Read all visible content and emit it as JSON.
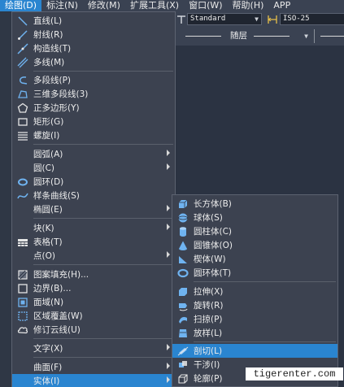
{
  "menubar": [
    {
      "label": "绘图(D)",
      "active": true
    },
    {
      "label": "标注(N)"
    },
    {
      "label": "修改(M)"
    },
    {
      "label": "扩展工具(X)"
    },
    {
      "label": "窗口(W)"
    },
    {
      "label": "帮助(H)"
    },
    {
      "label": "APP"
    }
  ],
  "toolbar": {
    "text_style": "Standard",
    "dim_style": "ISO-25",
    "layer": "随层"
  },
  "draw_menu": {
    "items": [
      {
        "label": "直线(L)",
        "icon": "line-icon"
      },
      {
        "label": "射线(R)",
        "icon": "ray-icon"
      },
      {
        "label": "构造线(T)",
        "icon": "xline-icon"
      },
      {
        "label": "多线(M)",
        "icon": "mline-icon"
      },
      {
        "label": "多段线(P)",
        "icon": "polyline-icon"
      },
      {
        "label": "三维多段线(3)",
        "icon": "3dpolyline-icon"
      },
      {
        "label": "正多边形(Y)",
        "icon": "polygon-icon"
      },
      {
        "label": "矩形(G)",
        "icon": "rectangle-icon"
      },
      {
        "label": "螺旋(I)",
        "icon": "helix-icon"
      },
      {
        "label": "圆弧(A)",
        "submenu": true
      },
      {
        "label": "圆(C)",
        "submenu": true
      },
      {
        "label": "圆环(D)",
        "icon": "donut-icon"
      },
      {
        "label": "样条曲线(S)",
        "icon": "spline-icon"
      },
      {
        "label": "椭圆(E)",
        "submenu": true
      },
      {
        "label": "块(K)",
        "submenu": true
      },
      {
        "label": "表格(T)",
        "icon": "table-icon"
      },
      {
        "label": "点(O)",
        "submenu": true
      },
      {
        "label": "图案填充(H)...",
        "icon": "hatch-icon"
      },
      {
        "label": "边界(B)...",
        "icon": "boundary-icon"
      },
      {
        "label": "面域(N)",
        "icon": "region-icon"
      },
      {
        "label": "区域覆盖(W)",
        "icon": "wipeout-icon"
      },
      {
        "label": "修订云线(U)",
        "icon": "revcloud-icon"
      },
      {
        "label": "文字(X)",
        "submenu": true
      },
      {
        "label": "曲面(F)",
        "submenu": true
      },
      {
        "label": "实体(I)",
        "submenu": true,
        "highlighted": true
      }
    ]
  },
  "solid_menu": {
    "items": [
      {
        "label": "长方体(B)",
        "icon": "box-icon"
      },
      {
        "label": "球体(S)",
        "icon": "sphere-icon"
      },
      {
        "label": "圆柱体(C)",
        "icon": "cylinder-icon"
      },
      {
        "label": "圆锥体(O)",
        "icon": "cone-icon"
      },
      {
        "label": "楔体(W)",
        "icon": "wedge-icon"
      },
      {
        "label": "圆环体(T)",
        "icon": "torus-icon"
      },
      {
        "label": "拉伸(X)",
        "icon": "extrude-icon"
      },
      {
        "label": "旋转(R)",
        "icon": "revolve-icon"
      },
      {
        "label": "扫掠(P)",
        "icon": "sweep-icon"
      },
      {
        "label": "放样(L)",
        "icon": "loft-icon"
      },
      {
        "label": "剖切(L)",
        "icon": "slice-icon",
        "highlighted": true
      },
      {
        "label": "干涉(I)",
        "icon": "interfere-icon"
      },
      {
        "label": "轮廓(P)",
        "icon": "profile-icon"
      }
    ]
  },
  "watermark": "tigerenter.com",
  "colors": {
    "accent": "#2a85d0",
    "menu_bg": "#3c4250",
    "icon_blue": "#6fb3f0"
  }
}
